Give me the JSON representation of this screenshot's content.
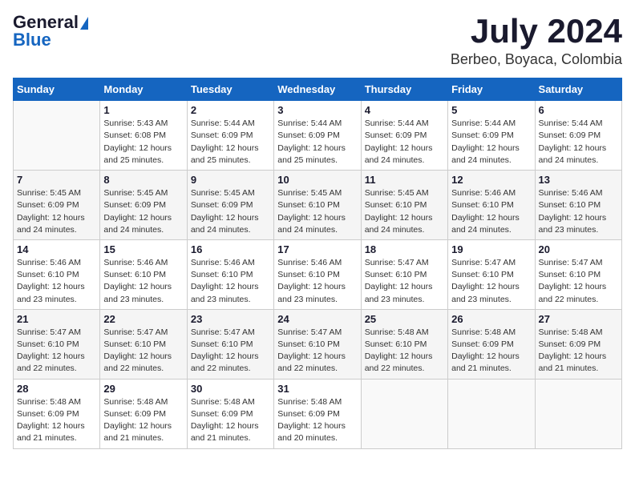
{
  "header": {
    "logo_line1": "General",
    "logo_line2": "Blue",
    "month": "July 2024",
    "location": "Berbeo, Boyaca, Colombia"
  },
  "days_of_week": [
    "Sunday",
    "Monday",
    "Tuesday",
    "Wednesday",
    "Thursday",
    "Friday",
    "Saturday"
  ],
  "weeks": [
    [
      {
        "day": "",
        "info": ""
      },
      {
        "day": "1",
        "info": "Sunrise: 5:43 AM\nSunset: 6:08 PM\nDaylight: 12 hours\nand 25 minutes."
      },
      {
        "day": "2",
        "info": "Sunrise: 5:44 AM\nSunset: 6:09 PM\nDaylight: 12 hours\nand 25 minutes."
      },
      {
        "day": "3",
        "info": "Sunrise: 5:44 AM\nSunset: 6:09 PM\nDaylight: 12 hours\nand 25 minutes."
      },
      {
        "day": "4",
        "info": "Sunrise: 5:44 AM\nSunset: 6:09 PM\nDaylight: 12 hours\nand 24 minutes."
      },
      {
        "day": "5",
        "info": "Sunrise: 5:44 AM\nSunset: 6:09 PM\nDaylight: 12 hours\nand 24 minutes."
      },
      {
        "day": "6",
        "info": "Sunrise: 5:44 AM\nSunset: 6:09 PM\nDaylight: 12 hours\nand 24 minutes."
      }
    ],
    [
      {
        "day": "7",
        "info": "Sunrise: 5:45 AM\nSunset: 6:09 PM\nDaylight: 12 hours\nand 24 minutes."
      },
      {
        "day": "8",
        "info": "Sunrise: 5:45 AM\nSunset: 6:09 PM\nDaylight: 12 hours\nand 24 minutes."
      },
      {
        "day": "9",
        "info": "Sunrise: 5:45 AM\nSunset: 6:09 PM\nDaylight: 12 hours\nand 24 minutes."
      },
      {
        "day": "10",
        "info": "Sunrise: 5:45 AM\nSunset: 6:10 PM\nDaylight: 12 hours\nand 24 minutes."
      },
      {
        "day": "11",
        "info": "Sunrise: 5:45 AM\nSunset: 6:10 PM\nDaylight: 12 hours\nand 24 minutes."
      },
      {
        "day": "12",
        "info": "Sunrise: 5:46 AM\nSunset: 6:10 PM\nDaylight: 12 hours\nand 24 minutes."
      },
      {
        "day": "13",
        "info": "Sunrise: 5:46 AM\nSunset: 6:10 PM\nDaylight: 12 hours\nand 23 minutes."
      }
    ],
    [
      {
        "day": "14",
        "info": "Sunrise: 5:46 AM\nSunset: 6:10 PM\nDaylight: 12 hours\nand 23 minutes."
      },
      {
        "day": "15",
        "info": "Sunrise: 5:46 AM\nSunset: 6:10 PM\nDaylight: 12 hours\nand 23 minutes."
      },
      {
        "day": "16",
        "info": "Sunrise: 5:46 AM\nSunset: 6:10 PM\nDaylight: 12 hours\nand 23 minutes."
      },
      {
        "day": "17",
        "info": "Sunrise: 5:46 AM\nSunset: 6:10 PM\nDaylight: 12 hours\nand 23 minutes."
      },
      {
        "day": "18",
        "info": "Sunrise: 5:47 AM\nSunset: 6:10 PM\nDaylight: 12 hours\nand 23 minutes."
      },
      {
        "day": "19",
        "info": "Sunrise: 5:47 AM\nSunset: 6:10 PM\nDaylight: 12 hours\nand 23 minutes."
      },
      {
        "day": "20",
        "info": "Sunrise: 5:47 AM\nSunset: 6:10 PM\nDaylight: 12 hours\nand 22 minutes."
      }
    ],
    [
      {
        "day": "21",
        "info": "Sunrise: 5:47 AM\nSunset: 6:10 PM\nDaylight: 12 hours\nand 22 minutes."
      },
      {
        "day": "22",
        "info": "Sunrise: 5:47 AM\nSunset: 6:10 PM\nDaylight: 12 hours\nand 22 minutes."
      },
      {
        "day": "23",
        "info": "Sunrise: 5:47 AM\nSunset: 6:10 PM\nDaylight: 12 hours\nand 22 minutes."
      },
      {
        "day": "24",
        "info": "Sunrise: 5:47 AM\nSunset: 6:10 PM\nDaylight: 12 hours\nand 22 minutes."
      },
      {
        "day": "25",
        "info": "Sunrise: 5:48 AM\nSunset: 6:10 PM\nDaylight: 12 hours\nand 22 minutes."
      },
      {
        "day": "26",
        "info": "Sunrise: 5:48 AM\nSunset: 6:09 PM\nDaylight: 12 hours\nand 21 minutes."
      },
      {
        "day": "27",
        "info": "Sunrise: 5:48 AM\nSunset: 6:09 PM\nDaylight: 12 hours\nand 21 minutes."
      }
    ],
    [
      {
        "day": "28",
        "info": "Sunrise: 5:48 AM\nSunset: 6:09 PM\nDaylight: 12 hours\nand 21 minutes."
      },
      {
        "day": "29",
        "info": "Sunrise: 5:48 AM\nSunset: 6:09 PM\nDaylight: 12 hours\nand 21 minutes."
      },
      {
        "day": "30",
        "info": "Sunrise: 5:48 AM\nSunset: 6:09 PM\nDaylight: 12 hours\nand 21 minutes."
      },
      {
        "day": "31",
        "info": "Sunrise: 5:48 AM\nSunset: 6:09 PM\nDaylight: 12 hours\nand 20 minutes."
      },
      {
        "day": "",
        "info": ""
      },
      {
        "day": "",
        "info": ""
      },
      {
        "day": "",
        "info": ""
      }
    ]
  ]
}
